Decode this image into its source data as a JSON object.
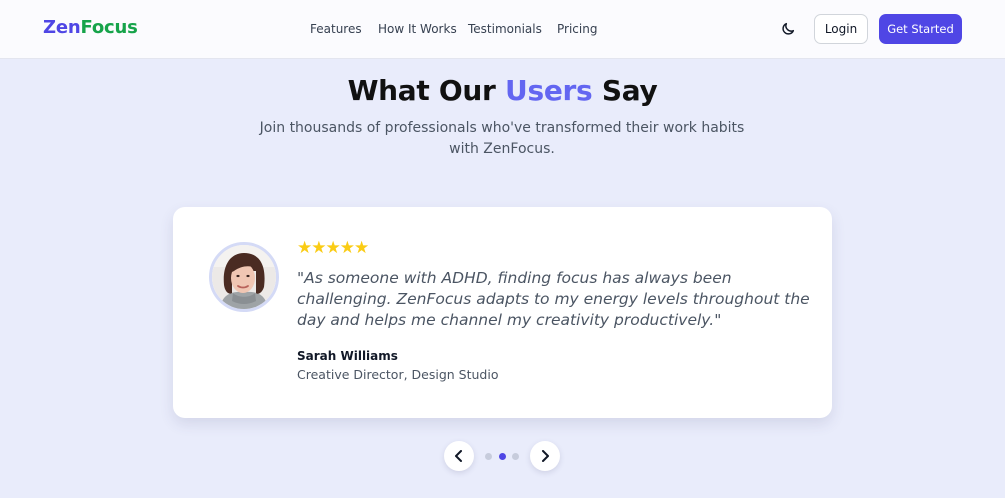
{
  "navbar": {
    "logo_part1": "Zen",
    "logo_part2": "Focus",
    "links": [
      "Features",
      "How It Works",
      "Testimonials",
      "Pricing"
    ],
    "login_label": "Login",
    "get_started_label": "Get Started",
    "theme_toggle_icon": "moon-icon"
  },
  "section": {
    "heading_before": "What Our ",
    "heading_accent": "Users",
    "heading_after": " Say",
    "subtitle": "Join thousands of professionals who've transformed their work habits with ZenFocus."
  },
  "testimonial": {
    "rating": 5,
    "stars": "★★★★★",
    "quote": "\"As someone with ADHD, finding focus has always been challenging. ZenFocus adapts to my energy levels throughout the day and helps me channel my creativity productively.\"",
    "author_name": "Sarah Williams",
    "author_role": "Creative Director, Design Studio"
  },
  "carousel": {
    "slide_count": 3,
    "active_index": 1,
    "prev_icon": "chevron-left-icon",
    "next_icon": "chevron-right-icon"
  },
  "colors": {
    "primary": "#4f46e5",
    "logo_green": "#16a34a",
    "accent": "#6366f1",
    "star": "#facc15",
    "background": "#e9ecfb"
  }
}
